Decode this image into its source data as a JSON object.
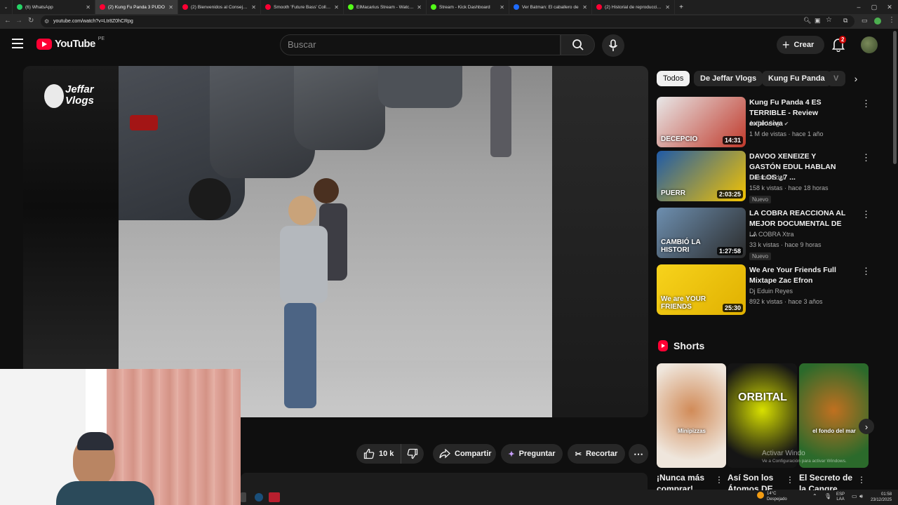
{
  "browser": {
    "tabs": [
      {
        "label": "(6) WhatsApp",
        "color": "#25d366",
        "active": false
      },
      {
        "label": "(2) Kung Fu Panda 3 PUDO",
        "color": "#ff0033",
        "active": true
      },
      {
        "label": "(2) Bienvenidos al Consejo Triba",
        "color": "#ff0033",
        "active": false
      },
      {
        "label": "Smooth 'Future Bass' Collection",
        "color": "#ff0033",
        "active": false
      },
      {
        "label": "ElMacarius Stream - Watch Live",
        "color": "#53fc18",
        "active": false
      },
      {
        "label": "Stream - Kick Dashboard",
        "color": "#53fc18",
        "active": false
      },
      {
        "label": "Ver Batman: El caballero de",
        "color": "#1e6bff",
        "active": false
      },
      {
        "label": "(2) Historial de reproducciones",
        "color": "#ff0033",
        "active": false
      }
    ],
    "new_tab": "+",
    "url": "youtube.com/watch?v=Ltr8Z0hCRpg"
  },
  "header": {
    "logo_text": "YouTube",
    "region": "PE",
    "search_placeholder": "Buscar",
    "create_label": "Crear",
    "notification_count": "2"
  },
  "player": {
    "channel_watermark_line1": "Jeffar",
    "channel_watermark_line2": "Vlogs"
  },
  "actions": {
    "like_count": "10 k",
    "share_label": "Compartir",
    "ask_label": "Preguntar",
    "clip_label": "Recortar"
  },
  "chips": [
    "Todos",
    "De Jeffar Vlogs",
    "Kung Fu Panda",
    "V"
  ],
  "recommendations": [
    {
      "title": "Kung Fu Panda 4  ES TERRIBLE - Review explosiva",
      "channel": "Jeffar Vlogs",
      "verified": true,
      "meta": "1 M de vistas · hace 1 año",
      "duration": "14:31",
      "badge": "",
      "thumb_text": "DECEPCIO",
      "colors": [
        "#e8e8e8",
        "#c0392b"
      ]
    },
    {
      "title": "DAVOO XENEIZE Y GASTÓN EDUL HABLAN DE LOS ¿7 ...",
      "channel": "Gastón Edul",
      "verified": false,
      "meta": "158 k vistas · hace 18 horas",
      "duration": "2:03:25",
      "badge": "Nuevo",
      "thumb_text": "PUERR",
      "colors": [
        "#1e5aa8",
        "#f5c400"
      ]
    },
    {
      "title": "LA COBRA REACCIONA AL MEJOR DOCUMENTAL DE ...",
      "channel": "LA COBRA Xtra",
      "verified": false,
      "meta": "33 k vistas · hace 9 horas",
      "duration": "1:27:58",
      "badge": "Nuevo",
      "thumb_text": "CAMBIÓ LA HISTORI",
      "colors": [
        "#6d8fb0",
        "#2b2b2b"
      ]
    },
    {
      "title": "We Are Your Friends Full Mixtape Zac Efron",
      "channel": "Dj Eduin Reyes",
      "verified": false,
      "meta": "892 k vistas · hace 3 años",
      "duration": "25:30",
      "badge": "",
      "thumb_text": "We are YOUR FRIENDS",
      "colors": [
        "#f7d31c",
        "#e0b000"
      ]
    }
  ],
  "shorts": {
    "heading": "Shorts",
    "items": [
      {
        "title": "¡Nunca más comprar!",
        "thumb_text": "Minipizzas",
        "colors": [
          "#efe6dc",
          "#d18b58"
        ]
      },
      {
        "title": "Así Son los Átomos DE",
        "thumb_text": "ORBITAL",
        "colors": [
          "#151515",
          "#d8e000"
        ]
      },
      {
        "title": "El Secreto de la Cangre",
        "thumb_text": "el fondo del mar",
        "colors": [
          "#2b6a2b",
          "#c07020"
        ]
      }
    ]
  },
  "overlay": {
    "activate_line1": "Activar Windo",
    "activate_line2": "Ve a Configuración para activar Windows."
  },
  "taskbar": {
    "weather_temp": "14°C",
    "weather_desc": "Despejado",
    "lang_line1": "ESP",
    "lang_line2": "LAA",
    "time": "01:58",
    "date": "23/12/2025"
  }
}
